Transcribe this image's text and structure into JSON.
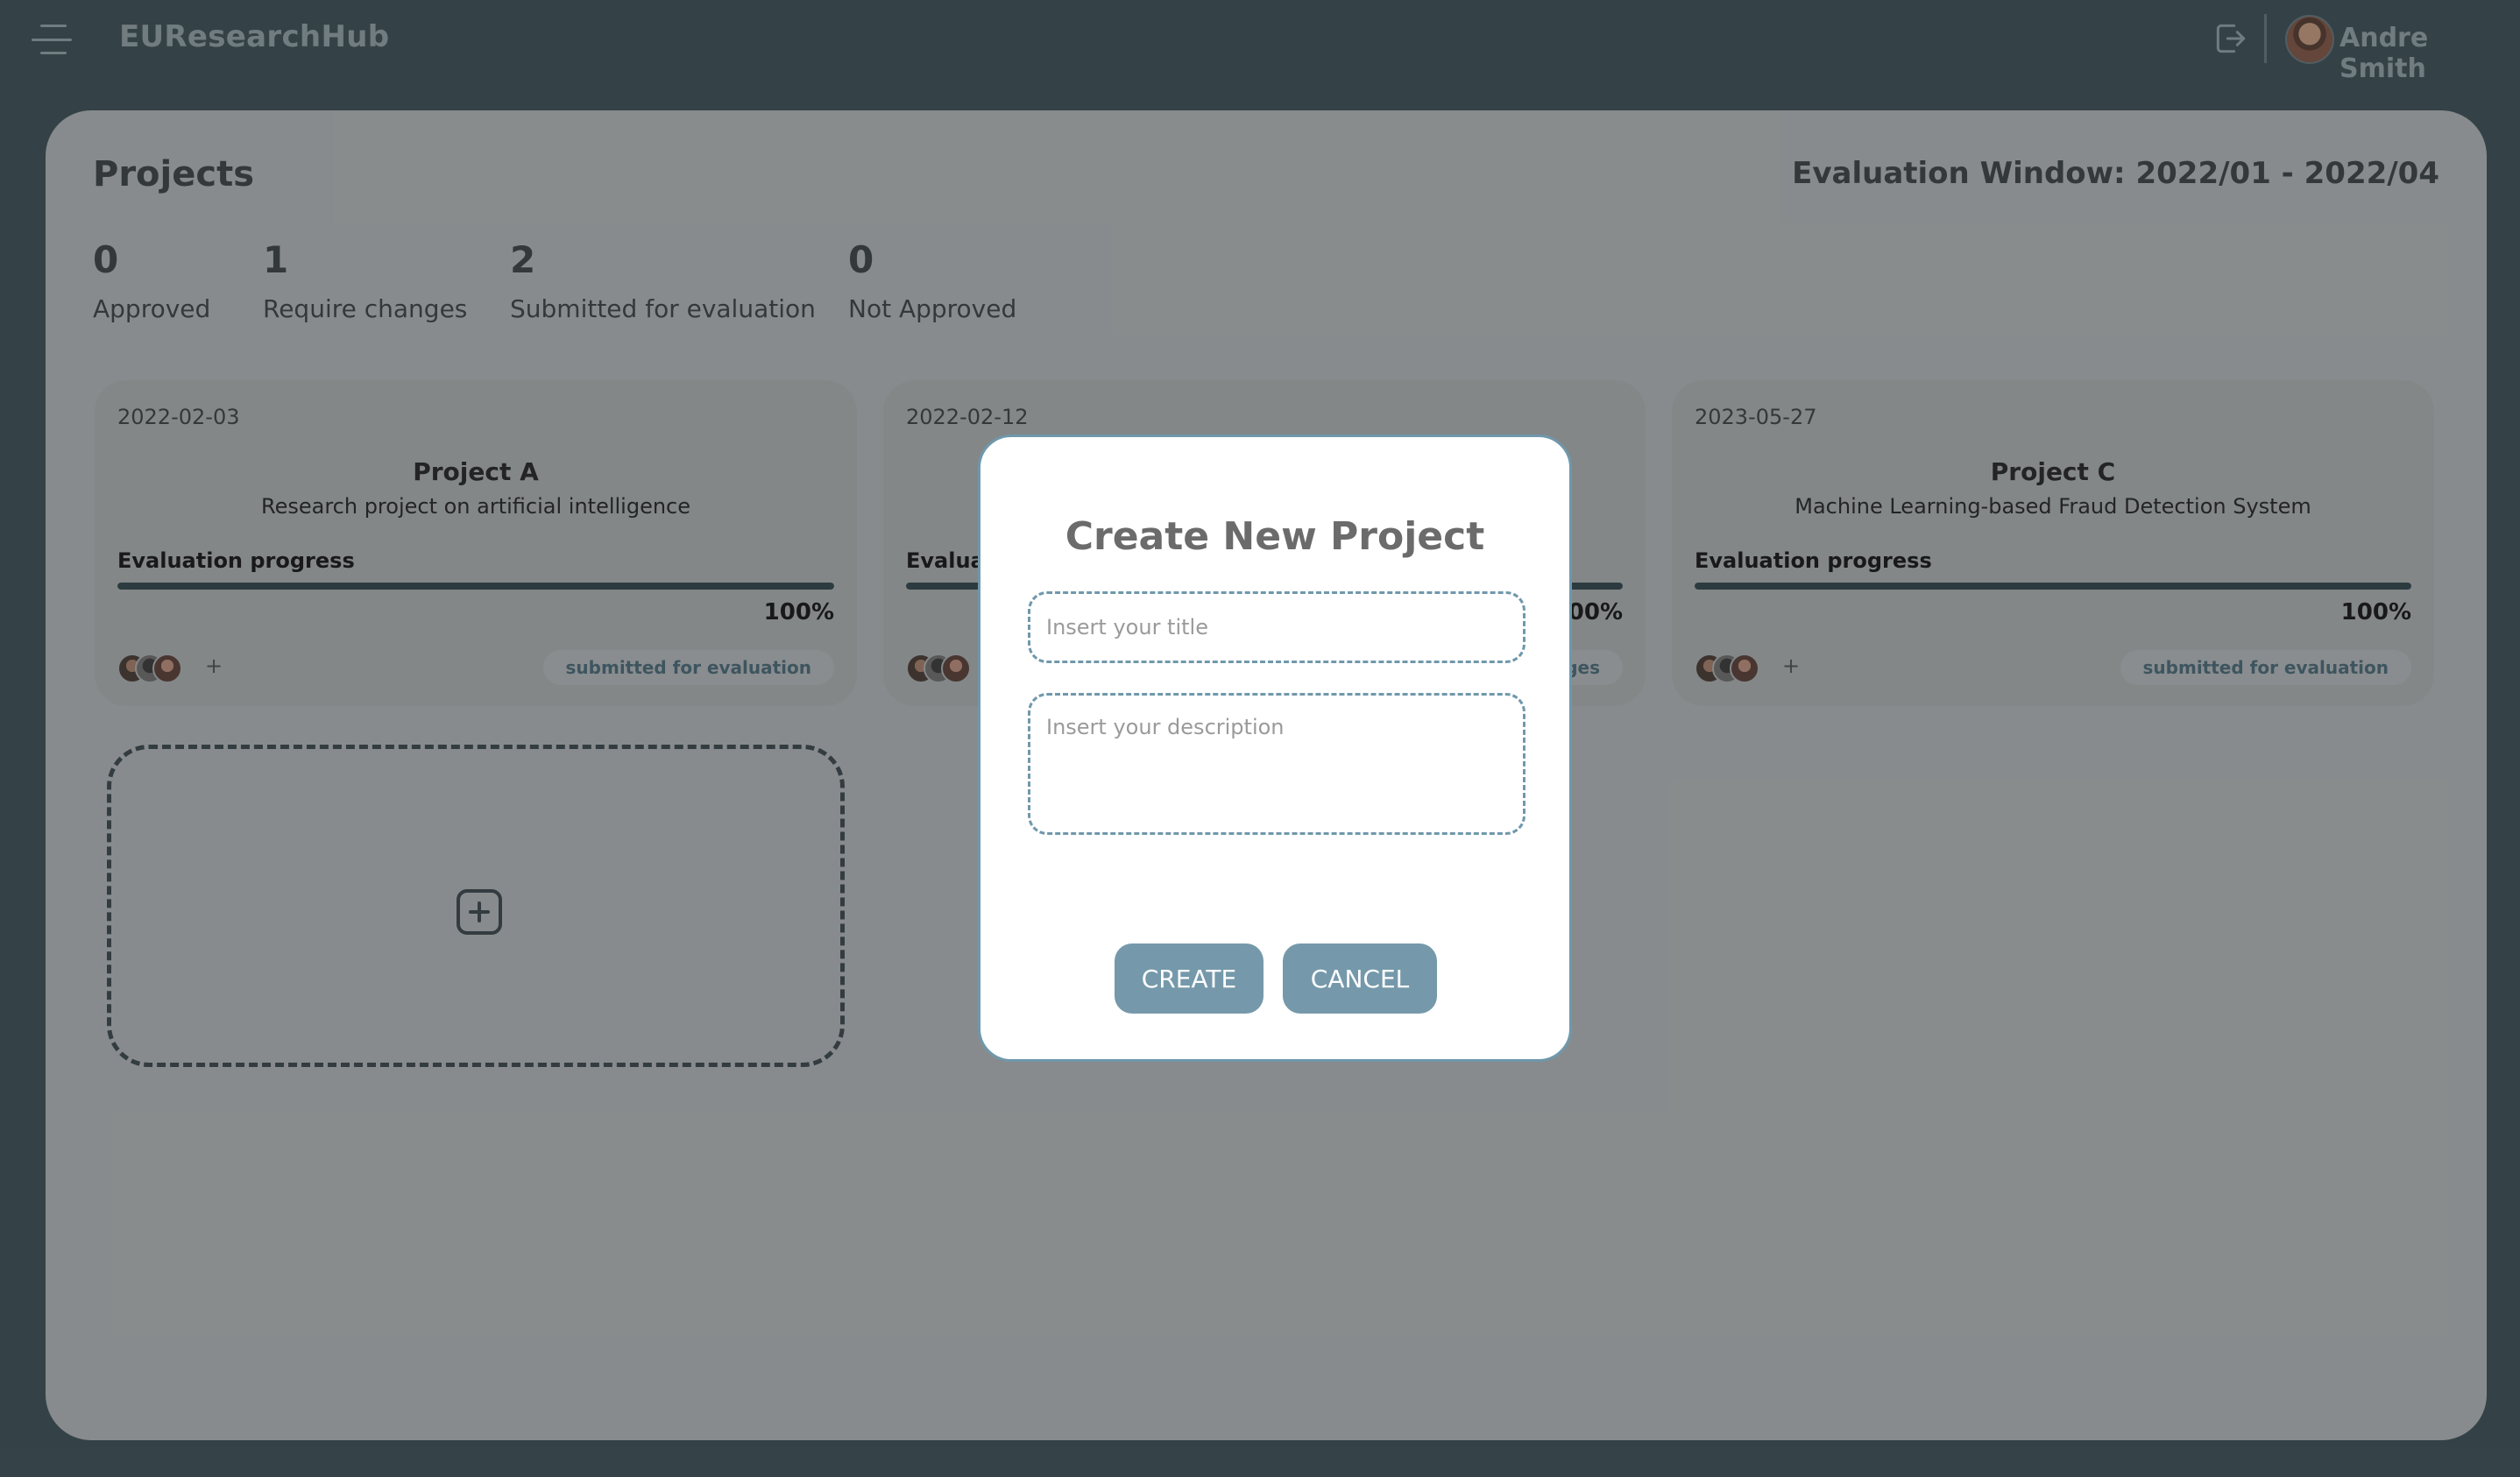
{
  "app": {
    "brand": "EUResearchHub"
  },
  "header": {
    "user_name": "Andre Smith"
  },
  "page": {
    "title": "Projects",
    "evaluation_window": "Evaluation Window: 2022/01 - 2022/04"
  },
  "stats": [
    {
      "value": "0",
      "label": "Approved"
    },
    {
      "value": "1",
      "label": "Require changes"
    },
    {
      "value": "2",
      "label": "Submitted for evaluation"
    },
    {
      "value": "0",
      "label": "Not Approved"
    }
  ],
  "projects": [
    {
      "date": "2022-02-03",
      "title": "Project A",
      "description": "Research project on artificial intelligence",
      "progress_label": "Evaluation progress",
      "progress": 100,
      "progress_text": "100%",
      "plus": "+",
      "status": "submitted for evaluation"
    },
    {
      "date": "2022-02-12",
      "title": "",
      "description": "",
      "progress_label": "Evaluation progress",
      "progress": 100,
      "progress_text": "100%",
      "plus": "+",
      "status": "require changes"
    },
    {
      "date": "2023-05-27",
      "title": "Project C",
      "description": "Machine Learning-based Fraud Detection System",
      "progress_label": "Evaluation progress",
      "progress": 100,
      "progress_text": "100%",
      "plus": "+",
      "status": "submitted for evaluation"
    }
  ],
  "modal": {
    "title": "Create New Project",
    "title_placeholder": "Insert your title",
    "title_value": "",
    "description_placeholder": "Insert your description",
    "description_value": "",
    "create_label": "CREATE",
    "cancel_label": "CANCEL"
  },
  "colors": {
    "background": "#3d535b",
    "accent": "#7599aa",
    "modal_border": "#6f98ab"
  },
  "icons": {
    "menu": "hamburger-menu-icon",
    "logout": "logout-icon",
    "add": "plus-square-icon"
  }
}
